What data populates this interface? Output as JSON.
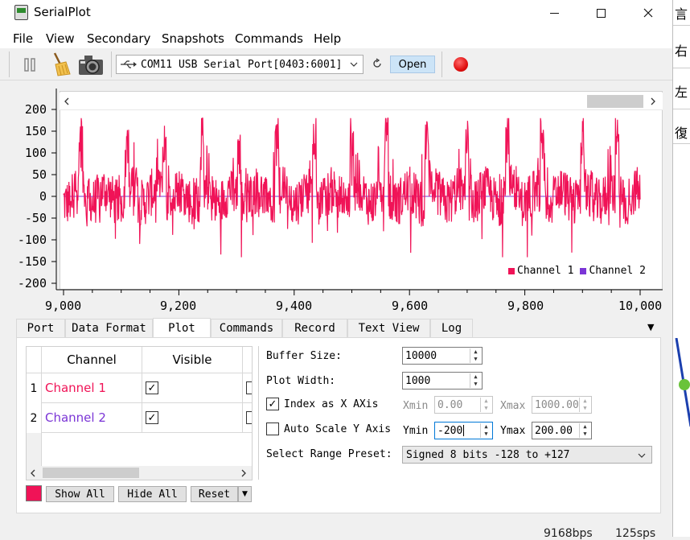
{
  "window": {
    "title": "SerialPlot"
  },
  "menu": [
    "File",
    "View",
    "Secondary",
    "Snapshots",
    "Commands",
    "Help"
  ],
  "toolbar": {
    "port": "COM11 USB Serial Port[0403:6001]",
    "open_label": "Open"
  },
  "plot": {
    "y_ticks": [
      "200",
      "150",
      "100",
      "50",
      "0",
      "-50",
      "-100",
      "-150",
      "-200"
    ],
    "x_ticks": [
      "9,000",
      "9,200",
      "9,400",
      "9,600",
      "9,800",
      "10,000"
    ],
    "legend": [
      "Channel 1",
      "Channel 2"
    ]
  },
  "chart_data": {
    "type": "line",
    "x": [
      9000,
      10000
    ],
    "xlim": [
      9000,
      10000
    ],
    "ylim": [
      -200,
      200
    ],
    "series": [
      {
        "name": "Channel 1",
        "color": "#f01357"
      },
      {
        "name": "Channel 2",
        "color": "#7b35d6"
      }
    ],
    "grid": false,
    "legend_position": "bottom-right"
  },
  "tabs": [
    "Port",
    "Data Format",
    "Plot",
    "Commands",
    "Record",
    "Text View",
    "Log"
  ],
  "channels": {
    "header_channel": "Channel",
    "header_visible": "Visible",
    "rows": [
      {
        "num": "1",
        "name": "Channel 1",
        "color": "#f01357"
      },
      {
        "num": "2",
        "name": "Channel 2",
        "color": "#7b35d6"
      }
    ],
    "swatch_color": "#f01357"
  },
  "buttons": {
    "show_all": "Show All",
    "hide_all": "Hide All",
    "reset": "Reset"
  },
  "settings": {
    "buffer_label": "Buffer Size:",
    "buffer_value": "10000",
    "width_label": "Plot Width:",
    "width_value": "1000",
    "index_label": "Index as X AXis",
    "xmin_label": "Xmin",
    "xmin_value": "0.00",
    "xmax_label": "Xmax",
    "xmax_value": "1000.00",
    "auto_label": "Auto Scale Y Axis",
    "ymin_label": "Ymin",
    "ymin_value": "-200",
    "ymax_label": "Ymax",
    "ymax_value": "200.00",
    "preset_label": "Select Range Preset:",
    "preset_value": "Signed 8 bits -128 to +127"
  },
  "status": {
    "bps": "9168bps",
    "sps": "125sps"
  },
  "background_window": [
    "言",
    "右",
    "左",
    "復"
  ]
}
